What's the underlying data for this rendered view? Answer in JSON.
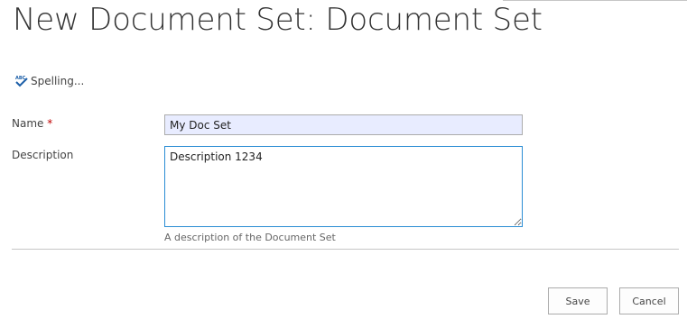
{
  "page": {
    "title": "New Document Set: Document Set"
  },
  "toolbar": {
    "spelling_label": "Spelling..."
  },
  "form": {
    "name": {
      "label": "Name",
      "required_marker": "*",
      "value": "My Doc Set"
    },
    "description": {
      "label": "Description",
      "value": "Description 1234",
      "hint": "A description of the Document Set"
    }
  },
  "actions": {
    "save_label": "Save",
    "cancel_label": "Cancel"
  },
  "colors": {
    "name_field_bg": "#e8ecff",
    "focus_border": "#2a8dd4",
    "required": "#bf0000"
  }
}
